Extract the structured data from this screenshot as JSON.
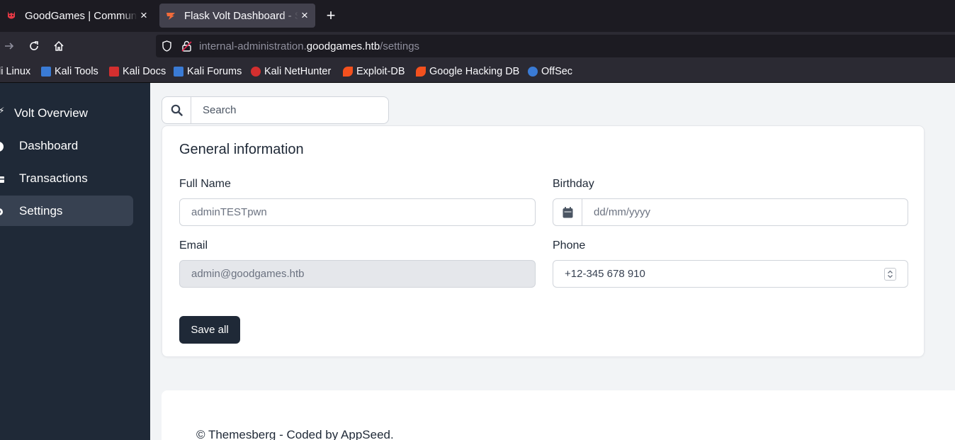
{
  "browser": {
    "tabs": [
      {
        "title": "GoodGames | Community and Store",
        "active": false
      },
      {
        "title": "Flask Volt Dashboard - Settings",
        "active": true
      }
    ],
    "new_tab_icon": "plus-icon",
    "close_glyph": "×",
    "new_tab_glyph": "+",
    "url": {
      "prefix": "internal-administration.",
      "domain": "goodgames.htb",
      "path": "/settings"
    },
    "bookmarks": [
      {
        "label": "li Linux",
        "icon_color": "#367bf0"
      },
      {
        "label": "Kali Tools",
        "icon_color": "#3a7bd5"
      },
      {
        "label": "Kali Docs",
        "icon_color": "#d32f2f"
      },
      {
        "label": "Kali Forums",
        "icon_color": "#3a7bd5"
      },
      {
        "label": "Kali NetHunter",
        "icon_color": "#d32f2f"
      },
      {
        "label": "Exploit-DB",
        "icon_color": "#f4511e"
      },
      {
        "label": "Google Hacking DB",
        "icon_color": "#f4511e"
      },
      {
        "label": "OffSec",
        "icon_color": "#3a7bd5"
      }
    ]
  },
  "sidebar": {
    "brand": "Volt Overview",
    "items": [
      {
        "label": "Dashboard",
        "icon": "pie-chart-icon",
        "active": false
      },
      {
        "label": "Transactions",
        "icon": "credit-card-icon",
        "active": false
      },
      {
        "label": "Settings",
        "icon": "gear-icon",
        "active": true
      }
    ]
  },
  "search": {
    "placeholder": "Search"
  },
  "general": {
    "title": "General information",
    "full_name": {
      "label": "Full Name",
      "value": "adminTESTpwn"
    },
    "birthday": {
      "label": "Birthday",
      "placeholder": "dd/mm/yyyy"
    },
    "email": {
      "label": "Email",
      "value": "admin@goodgames.htb"
    },
    "phone": {
      "label": "Phone",
      "value": "+12-345 678 910"
    },
    "save_label": "Save all"
  },
  "footer": {
    "text": "© Themesberg - Coded by AppSeed."
  },
  "colors": {
    "sidebar_bg": "#1f2937",
    "sidebar_active": "#374151",
    "button_bg": "#1f2937",
    "content_bg": "#f2f4f6"
  }
}
